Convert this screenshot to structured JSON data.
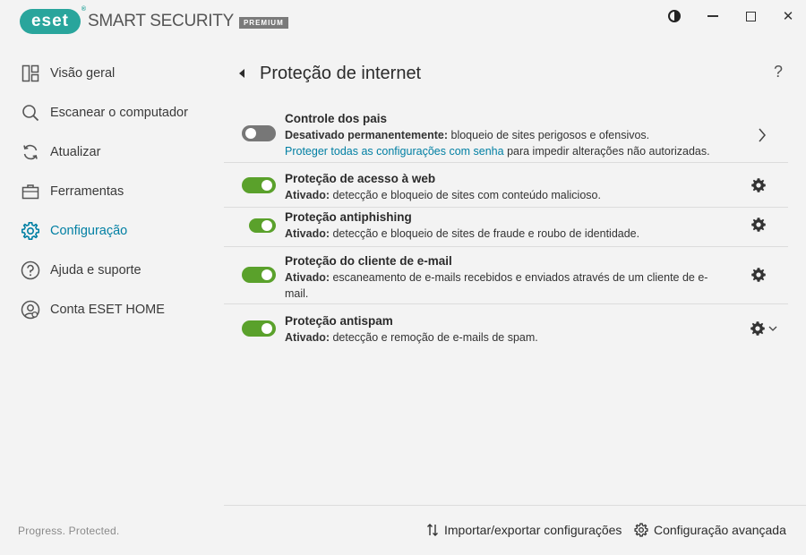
{
  "app": {
    "logo_text": "eset",
    "logo_reg": "®",
    "product_name": "SMART SECURITY",
    "edition": "PREMIUM",
    "tagline": "Progress. Protected.",
    "accent_color": "#29a59c",
    "active_color": "#007fa3",
    "toggle_on_color": "#5aa12b"
  },
  "window_controls": {
    "contrast_icon": "contrast-icon",
    "minimize_icon": "minimize-icon",
    "maximize_icon": "maximize-icon",
    "close_label": "✕"
  },
  "sidebar": {
    "items": [
      {
        "label": "Visão geral",
        "icon": "dashboard-icon",
        "active": false
      },
      {
        "label": "Escanear o computador",
        "icon": "search-icon",
        "active": false
      },
      {
        "label": "Atualizar",
        "icon": "refresh-icon",
        "active": false
      },
      {
        "label": "Ferramentas",
        "icon": "briefcase-icon",
        "active": false
      },
      {
        "label": "Configuração",
        "icon": "gear-icon",
        "active": true
      },
      {
        "label": "Ajuda e suporte",
        "icon": "help-circle-icon",
        "active": false
      },
      {
        "label": "Conta ESET HOME",
        "icon": "account-icon",
        "active": false
      }
    ]
  },
  "main": {
    "title": "Proteção de internet",
    "help_label": "?",
    "rows": [
      {
        "title": "Controle dos pais",
        "state": "off",
        "desc_bold": "Desativado permanentemente:",
        "desc": " bloqueio de sites perigosos e ofensivos.",
        "link": "Proteger todas as configurações com senha",
        "link_tail": " para impedir alterações não autorizadas.",
        "action": "chevron-right-icon"
      },
      {
        "title": "Proteção de acesso à web",
        "state": "on",
        "desc_bold": "Ativado:",
        "desc": " detecção e bloqueio de sites com conteúdo malicioso.",
        "action": "gear-icon"
      },
      {
        "title": "Proteção antiphishing",
        "state": "on",
        "desc_bold": "Ativado:",
        "desc": " detecção e bloqueio de sites de fraude e roubo de identidade.",
        "action": "gear-icon"
      },
      {
        "title": "Proteção do cliente de e-mail",
        "state": "on",
        "desc_bold": "Ativado:",
        "desc": " escaneamento de e-mails recebidos e enviados através de um cliente de e-mail.",
        "action": "gear-icon"
      },
      {
        "title": "Proteção antispam",
        "state": "on",
        "desc_bold": "Ativado:",
        "desc": " detecção e remoção de e-mails de spam.",
        "action": "gear-chevron-icon"
      }
    ]
  },
  "footer": {
    "import_label": "Importar/exportar configurações",
    "advanced_label": "Configuração avançada"
  }
}
